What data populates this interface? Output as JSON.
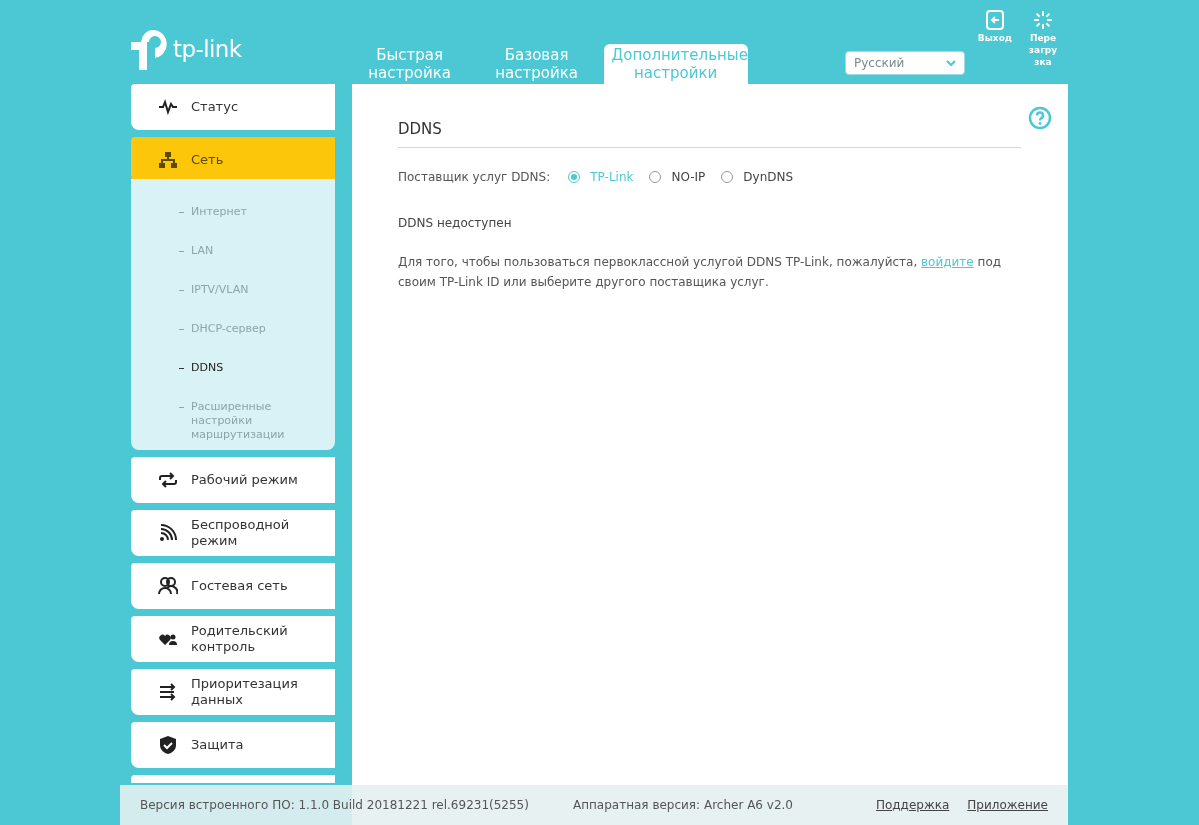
{
  "logo": {
    "text": "tp-link"
  },
  "tabs": [
    {
      "label": "Быстрая настройка",
      "selected": false
    },
    {
      "label": "Базовая настройка",
      "selected": false
    },
    {
      "label": "Дополнительные настройки",
      "selected": true
    }
  ],
  "language": {
    "value": "Русский"
  },
  "top_actions": [
    {
      "label": "Выход"
    },
    {
      "label": "Перезагрузка"
    }
  ],
  "sidebar": {
    "items": [
      {
        "label": "Статус",
        "selected": false
      },
      {
        "label": "Сеть",
        "selected": true,
        "expanded": true,
        "children": [
          {
            "label": "Интернет",
            "selected": false
          },
          {
            "label": "LAN",
            "selected": false
          },
          {
            "label": "IPTV/VLAN",
            "selected": false
          },
          {
            "label": "DHCP-сервер",
            "selected": false
          },
          {
            "label": "DDNS",
            "selected": true
          },
          {
            "label": "Расширенные настройки маршрутизации",
            "selected": false
          }
        ]
      },
      {
        "label": "Рабочий режим",
        "selected": false
      },
      {
        "label": "Беспроводной режим",
        "selected": false
      },
      {
        "label": "Гостевая сеть",
        "selected": false
      },
      {
        "label": "Родительский контроль",
        "selected": false
      },
      {
        "label": "Приоритезация данных",
        "selected": false
      },
      {
        "label": "Защита",
        "selected": false
      }
    ]
  },
  "content": {
    "title": "DDNS",
    "provider": {
      "label": "Поставщик услуг DDNS:",
      "options": [
        {
          "label": "TP-Link",
          "selected": true
        },
        {
          "label": "NO-IP",
          "selected": false
        },
        {
          "label": "DynDNS",
          "selected": false
        }
      ]
    },
    "status": "DDNS недоступен",
    "message": {
      "before": "Для того, чтобы пользоваться первоклассной услугой DDNS TP-Link, пожалуйста,",
      "link": "войдите",
      "after": "под своим TP-Link ID или выберите другого поставщика услуг."
    }
  },
  "footer": {
    "firmware": "Версия встроенного ПО: 1.1.0 Build 20181221 rel.69231(5255)",
    "hardware": "Аппаратная версия: Archer A6 v2.0",
    "links": [
      "Поддержка",
      "Приложение"
    ]
  }
}
